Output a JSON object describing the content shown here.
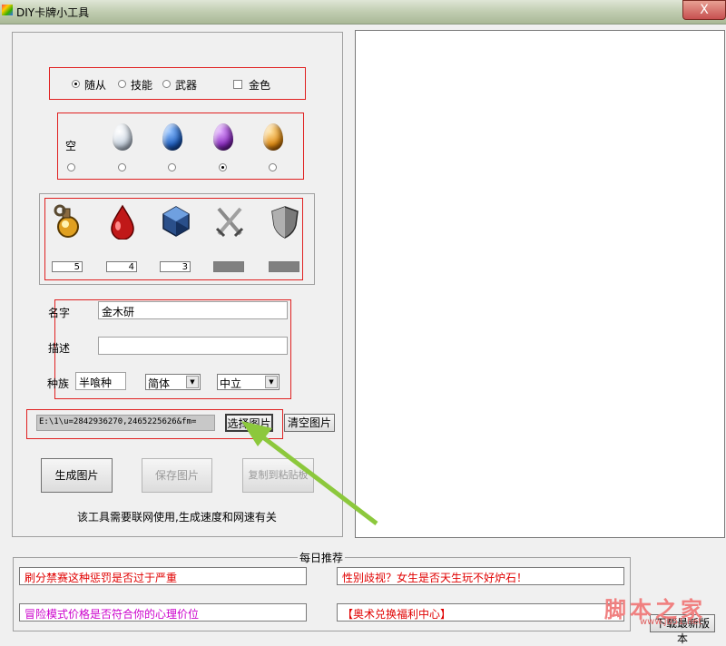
{
  "window": {
    "title": "DIY卡牌小工具",
    "close": "X"
  },
  "card_type": {
    "options": [
      {
        "label": "随从",
        "selected": true
      },
      {
        "label": "技能",
        "selected": false
      },
      {
        "label": "武器",
        "selected": false
      }
    ],
    "golden": {
      "label": "金色",
      "checked": false
    }
  },
  "rarity": {
    "empty_label": "空",
    "selected_index": 3,
    "gems": [
      {
        "name": "empty",
        "color": ""
      },
      {
        "name": "white-gem",
        "color": "#e8eef6"
      },
      {
        "name": "blue-gem",
        "color": "#1f5fbf"
      },
      {
        "name": "purple-gem",
        "color": "#8a2bbf"
      },
      {
        "name": "orange-gem",
        "color": "#e08a10"
      }
    ]
  },
  "stats": [
    {
      "icon": "mana-potion-icon",
      "value": "5",
      "enabled": true
    },
    {
      "icon": "blood-drop-icon",
      "value": "4",
      "enabled": true
    },
    {
      "icon": "crystal-icon",
      "value": "3",
      "enabled": true
    },
    {
      "icon": "crossed-swords-icon",
      "value": "",
      "enabled": false
    },
    {
      "icon": "shield-icon",
      "value": "",
      "enabled": false
    }
  ],
  "fields": {
    "name_label": "名字",
    "name_value": "金木研",
    "desc_label": "描述",
    "desc_value": "",
    "race_label": "种族",
    "race_value": "半喰种",
    "lang_select": "简体",
    "class_select": "中立"
  },
  "image_path": {
    "value": "E:\\1\\u=2842936270,2465225626&fm=",
    "choose_button": "选择图片",
    "clear_button": "清空图片"
  },
  "actions": {
    "generate": "生成图片",
    "save": "保存图片",
    "copy": "复制到粘贴板"
  },
  "notice": "该工具需要联网使用,生成速度和网速有关",
  "recommend": {
    "title": "每日推荐",
    "links": [
      {
        "text": "刷分禁赛这种惩罚是否过于严重",
        "color": "#e00000"
      },
      {
        "text": "性别歧视？女生是否天生玩不好炉石！",
        "color": "#e00000"
      },
      {
        "text": "冒险模式价格是否符合你的心理价位",
        "color": "#cc00cc"
      },
      {
        "text": "【奥术兑换福利中心】",
        "color": "#e00000"
      }
    ]
  },
  "download_button": "下载最新版本",
  "watermark": {
    "big": "脚本之家",
    "small": "www.jb51.net"
  },
  "colors": {
    "red_box": "#e02020",
    "arrow": "#8cc83c"
  }
}
